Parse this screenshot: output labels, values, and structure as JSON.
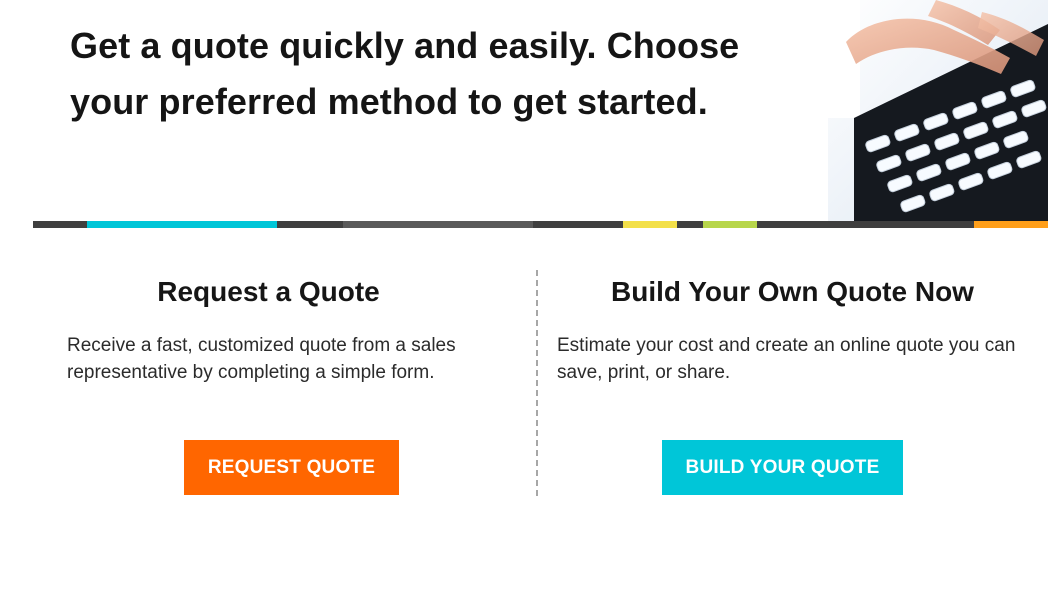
{
  "hero": {
    "title_line_1": "Get a quote quickly and easily. Choose",
    "title_line_2": "your preferred method to get started."
  },
  "left_panel": {
    "title": "Request a Quote",
    "description": "Receive a fast, customized quote from a sales representative by completing a simple form.",
    "button_label": "REQUEST QUOTE"
  },
  "right_panel": {
    "title": "Build Your Own Quote Now",
    "description": "Estimate your cost and create an online quote you can save, print, or share.",
    "button_label": "BUILD YOUR QUOTE"
  },
  "colors": {
    "primary_cta": "#ff6600",
    "secondary_cta": "#00c6d8",
    "divider": "#a7a7a7",
    "stripe_dark": "#3f3f3f",
    "stripe_mid": "#5a5a5a",
    "stripe_teal": "#00c6d8",
    "stripe_yellow": "#f3e04a",
    "stripe_green": "#b7d64b",
    "stripe_orange": "#ff9f1a"
  }
}
